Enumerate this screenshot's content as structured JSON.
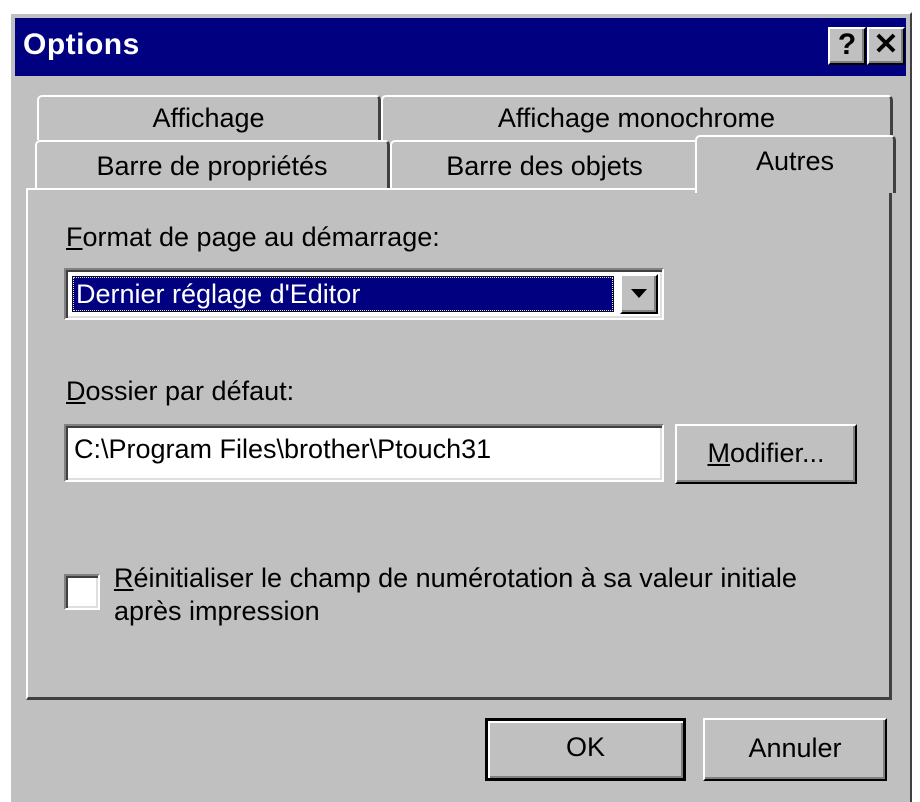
{
  "window": {
    "title": "Options",
    "help_button": "?",
    "close_button": "✕"
  },
  "tabs": {
    "row1": [
      "Affichage",
      "Affichage monochrome"
    ],
    "row2": [
      "Barre de propriétés",
      "Barre des objets"
    ],
    "active": "Autres"
  },
  "page_format": {
    "label_access": "F",
    "label_rest": "ormat de page au démarrage:",
    "selected_value": "Dernier réglage d'Editor"
  },
  "default_folder": {
    "label_access": "D",
    "label_rest": "ossier par défaut:",
    "value": "C:\\Program Files\\brother\\Ptouch31",
    "modify_access": "M",
    "modify_rest": "odifier..."
  },
  "reset_option": {
    "checked": false,
    "line1_access": "R",
    "line1_rest": "éinitialiser le champ de numérotation à sa valeur initiale",
    "line2": "après impression"
  },
  "buttons": {
    "ok": "OK",
    "cancel": "Annuler"
  }
}
